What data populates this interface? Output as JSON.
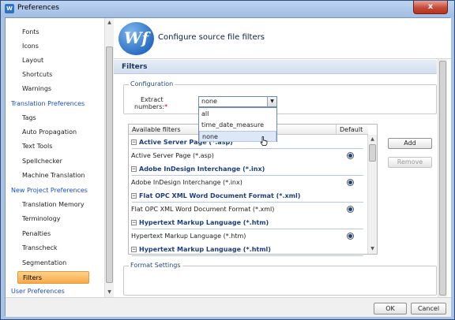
{
  "window": {
    "title": "Preferences",
    "app_icon": "W",
    "close_label": "x"
  },
  "nav": {
    "items": [
      {
        "label": "Fonts",
        "kind": "child"
      },
      {
        "label": "Icons",
        "kind": "child"
      },
      {
        "label": "Layout",
        "kind": "child"
      },
      {
        "label": "Shortcuts",
        "kind": "child"
      },
      {
        "label": "Warnings",
        "kind": "child"
      },
      {
        "label": "Translation Preferences",
        "kind": "group"
      },
      {
        "label": "Tags",
        "kind": "child"
      },
      {
        "label": "Auto Propagation",
        "kind": "child"
      },
      {
        "label": "Text Tools",
        "kind": "child"
      },
      {
        "label": "Spellchecker",
        "kind": "child"
      },
      {
        "label": "Machine Translation",
        "kind": "child"
      },
      {
        "label": "New Project Preferences",
        "kind": "group"
      },
      {
        "label": "Translation Memory",
        "kind": "child"
      },
      {
        "label": "Terminology",
        "kind": "child"
      },
      {
        "label": "Penalties",
        "kind": "child"
      },
      {
        "label": "Transcheck",
        "kind": "child"
      },
      {
        "label": "Segmentation",
        "kind": "child"
      },
      {
        "label": "Filters",
        "kind": "child",
        "selected": true
      },
      {
        "label": "User Preferences",
        "kind": "group"
      }
    ]
  },
  "header": {
    "logo_text": "Wf",
    "title": "Configure source file filters"
  },
  "section": {
    "title": "Filters"
  },
  "configuration": {
    "legend": "Configuration",
    "extract_label_line1": "Extract",
    "extract_label_line2": "numbers:",
    "required_mark": "*",
    "combo_value": "none",
    "options": [
      "all",
      "time_date_measure",
      "none"
    ],
    "hovered_option": "none"
  },
  "table": {
    "col_available": "Available filters",
    "col_default": "Default",
    "groups": [
      {
        "name": "Active Server Page (*.asp)",
        "item": "Active Server Page (*.asp)"
      },
      {
        "name": "Adobe InDesign Interchange (*.inx)",
        "item": "Adobe InDesign Interchange (*.inx)"
      },
      {
        "name": "Flat OPC XML Word Document Format (*.xml)",
        "item": "Flat OPC XML Word Document Format (*.xml)"
      },
      {
        "name": "Hypertext Markup Language (*.htm)",
        "item": "Hypertext Markup Language (*.htm)"
      },
      {
        "name": "Hypertext Markup Language (*.html)",
        "item": ""
      }
    ],
    "toggle_glyph": "−"
  },
  "buttons": {
    "add": "Add",
    "remove": "Remove",
    "ok": "OK",
    "cancel": "Cancel"
  },
  "format_settings": {
    "legend": "Format Settings"
  },
  "icons": {
    "logo": "wordfast-logo-icon",
    "cursor": "hand-pointer-icon",
    "scroll_up": "arrow-up-icon",
    "scroll_down": "arrow-down-icon",
    "dropdown": "chevron-down-icon",
    "close": "close-icon"
  },
  "colors": {
    "nav_group": "#1c4fbe",
    "selected_bg": "#f8a84a",
    "group_text": "#1c3e7d",
    "required": "#d00000"
  }
}
